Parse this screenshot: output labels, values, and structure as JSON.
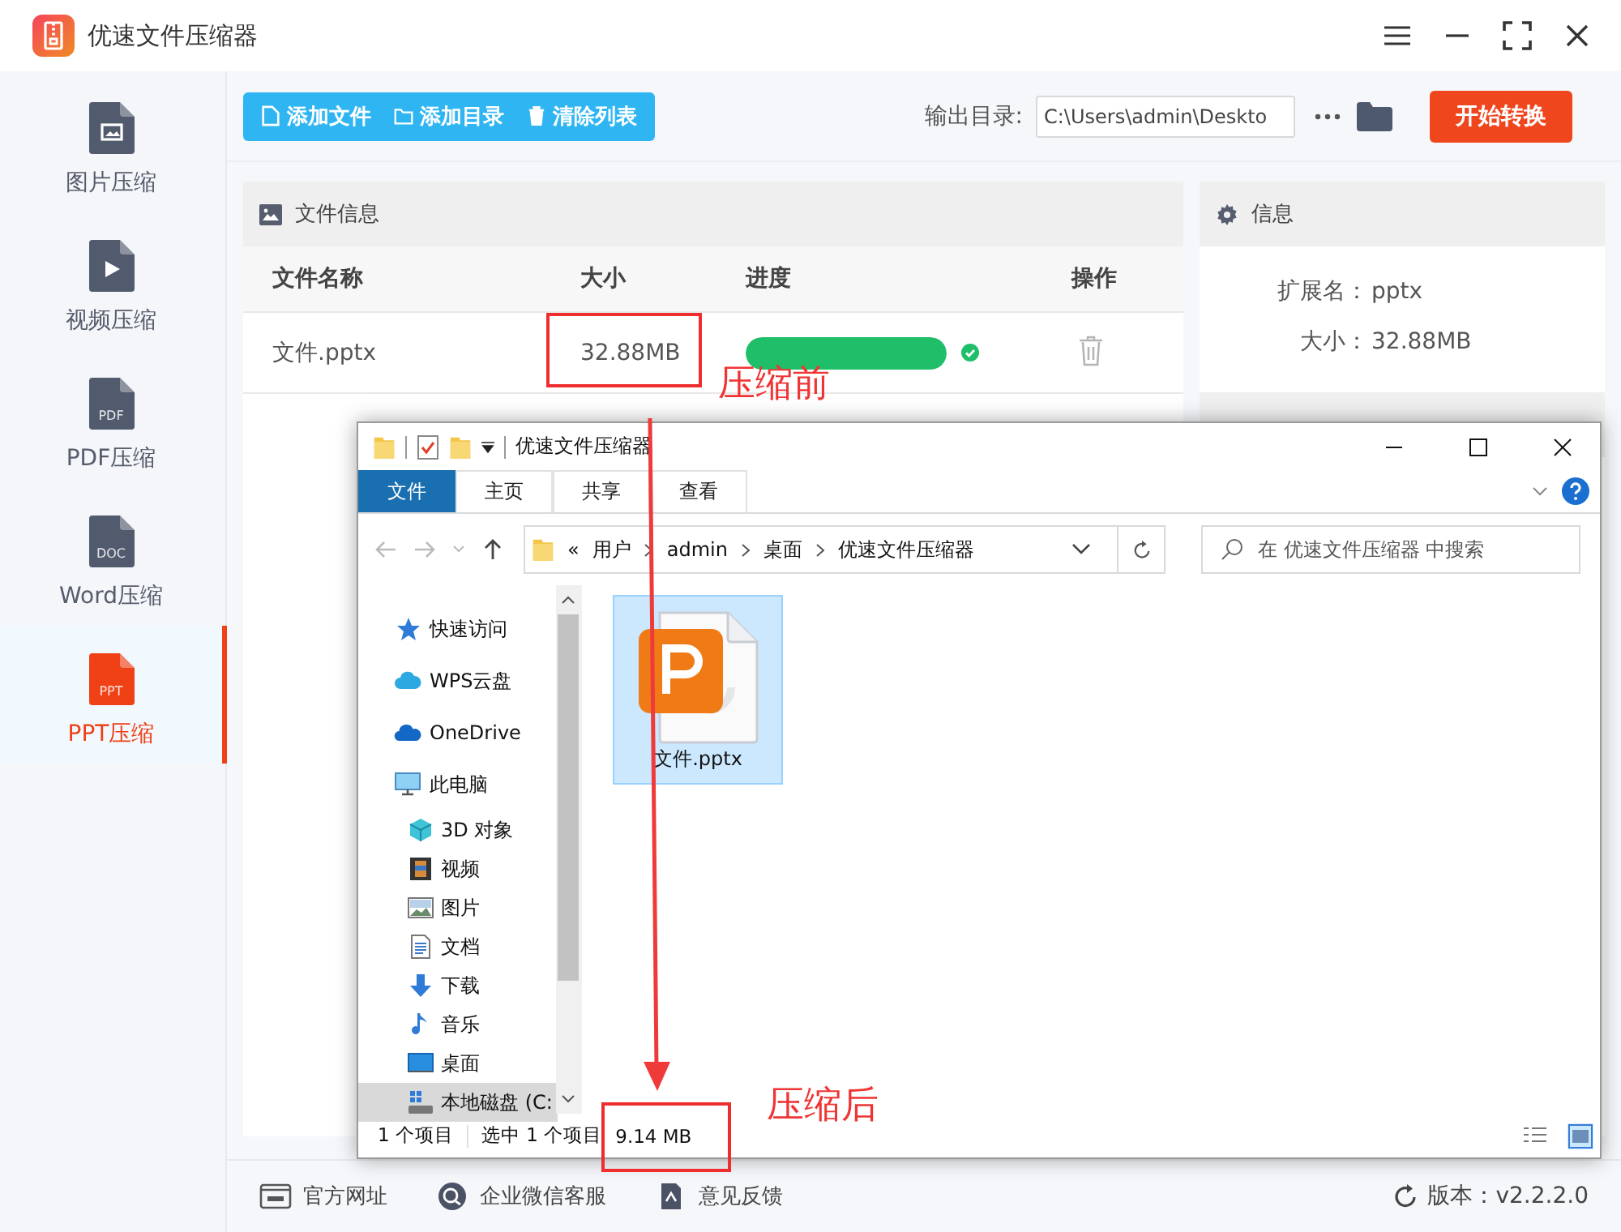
{
  "app": {
    "title": "优速文件压缩器"
  },
  "sidebar": {
    "items": [
      {
        "label": "图片压缩",
        "kind": "image",
        "selected": false
      },
      {
        "label": "视频压缩",
        "kind": "video",
        "selected": false
      },
      {
        "label": "PDF压缩",
        "kind": "typed",
        "badge": "PDF",
        "selected": false
      },
      {
        "label": "Word压缩",
        "kind": "typed",
        "badge": "DOC",
        "selected": false
      },
      {
        "label": "PPT压缩",
        "kind": "typed",
        "badge": "PPT",
        "selected": true
      }
    ]
  },
  "toolbar": {
    "buttons": [
      {
        "label": "添加文件",
        "kind": "file"
      },
      {
        "label": "添加目录",
        "kind": "folder"
      },
      {
        "label": "清除列表",
        "kind": "trash"
      }
    ],
    "output_label": "输出目录:",
    "output_path": "C:\\Users\\admin\\Deskto",
    "start_button": "开始转换"
  },
  "file_panel": {
    "title": "文件信息",
    "columns": [
      "文件名称",
      "大小",
      "进度",
      "操作"
    ],
    "rows": [
      {
        "name": "文件.pptx",
        "size": "32.88MB",
        "level": 1,
        "done": true
      }
    ]
  },
  "info_panel": {
    "title": "信息",
    "fields": [
      {
        "label": "扩展名：",
        "value": "pptx"
      },
      {
        "label": "大小：",
        "value": "32.88MB"
      }
    ]
  },
  "explorer": {
    "title": "优速文件压缩器",
    "ribbon_tabs": [
      {
        "label": "文件",
        "selected": true
      },
      {
        "label": "主页",
        "selected": false
      },
      {
        "label": "共享",
        "selected": false
      },
      {
        "label": "查看",
        "selected": false
      }
    ],
    "address": {
      "overflow": "«",
      "path": [
        "用户",
        "admin",
        "桌面",
        "优速文件压缩器"
      ]
    },
    "search": {
      "placeholder": "在 优速文件压缩器 中搜索"
    },
    "nav": [
      {
        "label": "快速访问",
        "kind": "star",
        "selected": false
      },
      {
        "label": "WPS云盘",
        "kind": "cloud",
        "selected": false
      },
      {
        "label": "OneDrive",
        "kind": "onedrive",
        "selected": false
      },
      {
        "label": "此电脑",
        "kind": "pc",
        "selected": false,
        "children": [
          {
            "label": "3D 对象",
            "kind": "cube",
            "selected": false
          },
          {
            "label": "视频",
            "kind": "film",
            "selected": false
          },
          {
            "label": "图片",
            "kind": "photo",
            "selected": false
          },
          {
            "label": "文档",
            "kind": "doc",
            "selected": false
          },
          {
            "label": "下载",
            "kind": "download",
            "selected": false
          },
          {
            "label": "音乐",
            "kind": "music",
            "selected": false
          },
          {
            "label": "桌面",
            "kind": "desktop",
            "selected": false
          },
          {
            "label": "本地磁盘 (C:",
            "kind": "drive",
            "selected": true
          }
        ]
      }
    ],
    "files": [
      {
        "name": "文件.pptx",
        "selected": true
      }
    ],
    "status": {
      "count": "1 个项目",
      "selection": "选中 1 个项目",
      "size": "9.14 MB"
    }
  },
  "annotations": [
    {
      "text": "压缩前"
    },
    {
      "text": "压缩后"
    }
  ],
  "footer": {
    "links": [
      {
        "label": "官方网址",
        "kind": "web"
      },
      {
        "label": "企业微信客服",
        "kind": "chat"
      },
      {
        "label": "意见反馈",
        "kind": "feedback"
      }
    ],
    "version": "版本：v2.2.2.0"
  }
}
